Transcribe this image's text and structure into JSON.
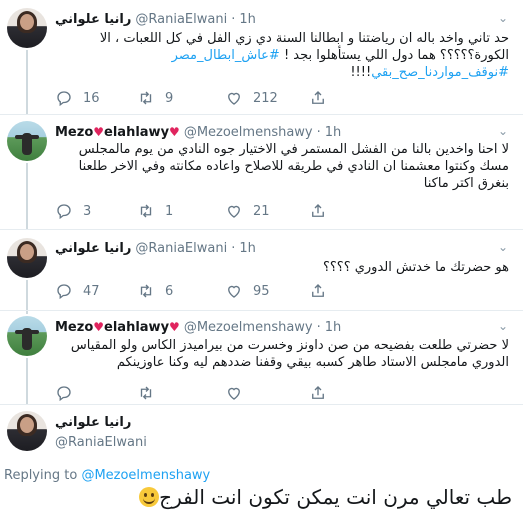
{
  "tweets": [
    {
      "name": "رانيا علواني",
      "handle": "@RaniaElwani",
      "time": "1h",
      "text_main": "حد تاني واخد باله ان رياضتنا و ابطالنا السنة دي زي الفل في كل اللعبات ، الا الكورة؟؟؟؟؟ هما دول اللي يستأهلوا بجد !",
      "hashtag1": "#عاش_ابطال_مصر",
      "hashtag2": "#نوقف_مواردنا_صح_بقي",
      "tail": "!!!!",
      "replies": "16",
      "retweets": "9",
      "likes": "212"
    },
    {
      "name_part1": "Mezo",
      "name_part2": "elahlawy",
      "heart1": "♥",
      "heart2": "♥",
      "handle": "@Mezoelmenshawy",
      "time": "1h",
      "text": "لا احنا واخدين بالنا من الفشل المستمر في الاختيار جوه النادي من يوم مالمجلس مسك وكنتوا معشمنا ان النادي في طريقه للاصلاح واعاده مكانته وفي الاخر طلعنا بنغرق اكتر ماكنا",
      "replies": "3",
      "retweets": "1",
      "likes": "21"
    },
    {
      "name": "رانيا علواني",
      "handle": "@RaniaElwani",
      "time": "1h",
      "text": "هو حضرتك ما خدتش الدوري ؟؟؟؟",
      "replies": "47",
      "retweets": "6",
      "likes": "95"
    },
    {
      "name_part1": "Mezo",
      "name_part2": "elahlawy",
      "heart1": "♥",
      "heart2": "♥",
      "handle": "@Mezoelmenshawy",
      "time": "1h",
      "text": "لا حضرتي طلعت بفضيحه من صن داونز وخسرت من بيراميدز الكاس ولو المقياس الدوري مامجلس الاستاد طاهر كسبه بيقي وقفنا ضددهم ليه وكنا عاوزينكم",
      "replies": "",
      "retweets": "",
      "likes": ""
    }
  ],
  "composer": {
    "name": "رانيا علواني",
    "handle": "@RaniaElwani",
    "replying_prefix": "Replying to",
    "replying_handle": "@Mezoelmenshawy",
    "big_text": "طب تعالي مرن انت يمكن تكون انت الفرج",
    "emoji": "grinning-face-emoji"
  },
  "icons": {
    "reply": "reply-icon",
    "retweet": "retweet-icon",
    "like": "like-icon",
    "share": "share-icon",
    "more": "chevron-down-icon"
  },
  "colors": {
    "text": "#14171a",
    "muted": "#657786",
    "link": "#1da1f2",
    "heart": "#e0245e",
    "divider": "#e6ecf0"
  }
}
